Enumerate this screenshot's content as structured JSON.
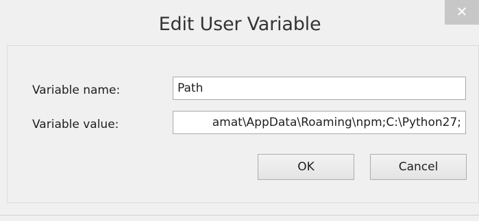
{
  "dialog": {
    "title": "Edit User Variable",
    "close_label": "✕"
  },
  "form": {
    "name_label": "Variable name:",
    "name_value": "Path",
    "value_label": "Variable value:",
    "value_value": "amat\\AppData\\Roaming\\npm;C:\\Python27;"
  },
  "buttons": {
    "ok_label": "OK",
    "cancel_label": "Cancel"
  }
}
